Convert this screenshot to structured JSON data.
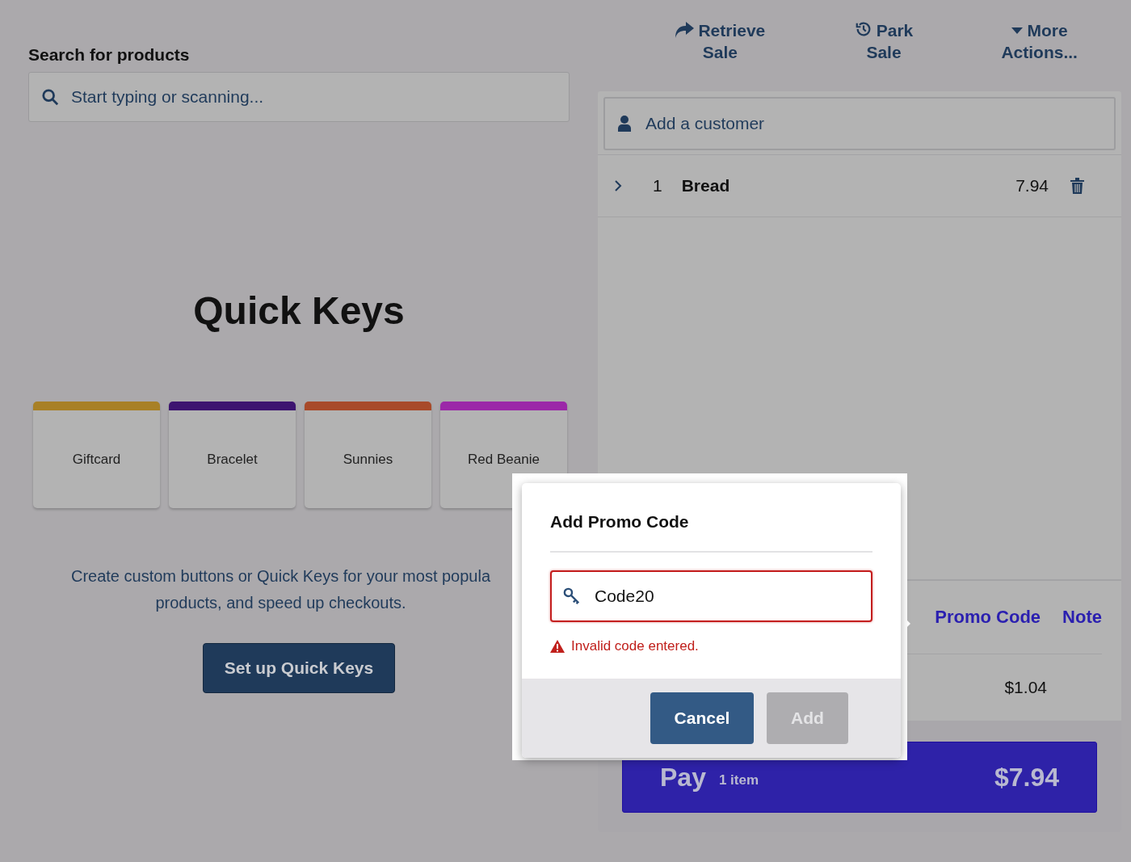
{
  "header_actions": [
    {
      "label": "Retrieve Sale"
    },
    {
      "label": "Park Sale"
    },
    {
      "label": "More Actions..."
    }
  ],
  "search": {
    "label": "Search for products",
    "placeholder": "Start typing or scanning..."
  },
  "quick_keys": {
    "title": "Quick Keys",
    "keys": [
      {
        "label": "Giftcard",
        "color": "#a88026"
      },
      {
        "label": "Bracelet",
        "color": "#3d1470"
      },
      {
        "label": "Sunnies",
        "color": "#a84a2a"
      },
      {
        "label": "Red Beanie",
        "color": "#9b28a8"
      }
    ],
    "description": "Create custom buttons or Quick Keys for your most popula products, and speed up checkouts.",
    "button": "Set up Quick Keys"
  },
  "sale": {
    "customer_placeholder": "Add a customer",
    "items": [
      {
        "qty": "1",
        "name": "Bread",
        "price": "7.94"
      }
    ],
    "links": [
      "Promo Code",
      "Note"
    ],
    "column_2": "$1.04",
    "pay": {
      "label": "Pay",
      "count": "1 item",
      "amount": "$7.94"
    }
  },
  "modal": {
    "title": "Add Promo Code",
    "value": "Code20",
    "error": "Invalid code entered.",
    "buttons": [
      {
        "label": "Cancel",
        "disabled": false
      },
      {
        "label": "Add",
        "disabled": true
      }
    ]
  }
}
